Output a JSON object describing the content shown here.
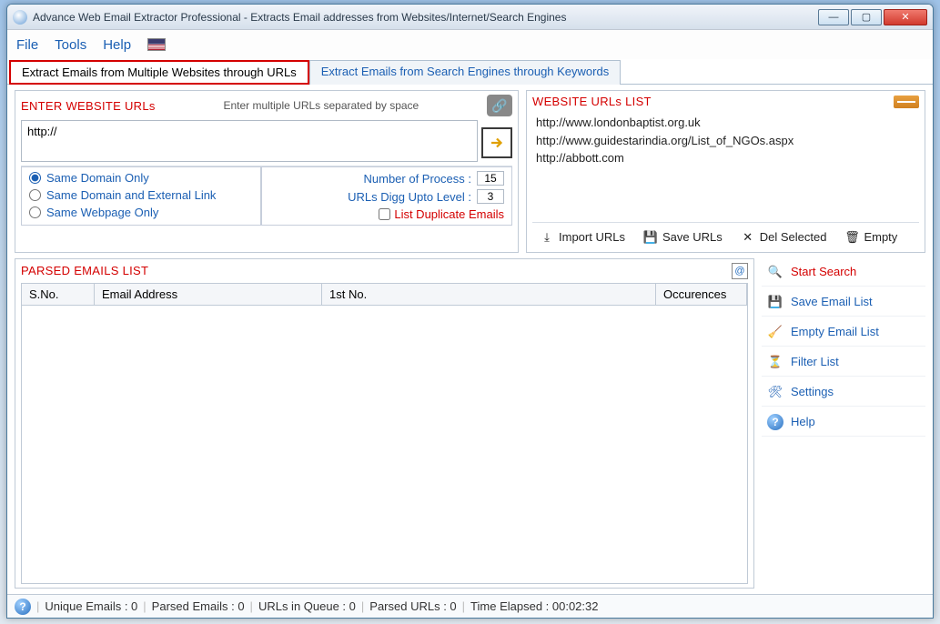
{
  "titlebar": {
    "title": "Advance Web Email Extractor Professional - Extracts Email addresses from Websites/Internet/Search Engines"
  },
  "menu": {
    "file": "File",
    "tools": "Tools",
    "help": "Help"
  },
  "tabs": {
    "urls": "Extract Emails from Multiple Websites through URLs",
    "keywords": "Extract Emails from Search Engines through Keywords"
  },
  "enterUrls": {
    "title": "ENTER WEBSITE URLs",
    "hint": "Enter multiple URLs separated by space",
    "value": "http://",
    "opt1": "Same Domain Only",
    "opt2": "Same Domain and External Link",
    "opt3": "Same Webpage Only",
    "numProc": "Number of Process :",
    "numProcVal": "15",
    "digg": "URLs Digg Upto Level :",
    "diggVal": "3",
    "listDup": "List Duplicate Emails"
  },
  "urlList": {
    "title": "WEBSITE URLs LIST",
    "items": [
      "http://www.londonbaptist.org.uk",
      "http://www.guidestarindia.org/List_of_NGOs.aspx",
      "http://abbott.com"
    ],
    "import": "Import URLs",
    "save": "Save URLs",
    "del": "Del Selected",
    "empty": "Empty"
  },
  "parsed": {
    "title": "PARSED EMAILS LIST",
    "cols": {
      "sno": "S.No.",
      "email": "Email Address",
      "first": "1st No.",
      "occ": "Occurences"
    }
  },
  "sidebar": {
    "start": "Start Search",
    "save": "Save Email List",
    "empty": "Empty Email List",
    "filter": "Filter List",
    "settings": "Settings",
    "help": "Help"
  },
  "status": {
    "unique": "Unique Emails :  0",
    "parsed": "Parsed Emails :  0",
    "queue": "URLs in Queue :  0",
    "parsedUrls": "Parsed URLs :  0",
    "elapsed": "Time Elapsed :   00:02:32"
  }
}
